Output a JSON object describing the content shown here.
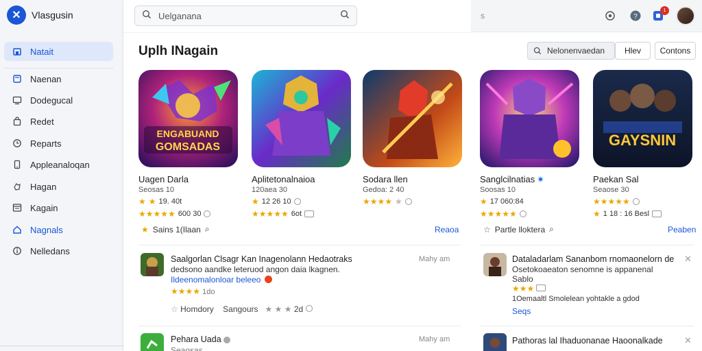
{
  "brand": {
    "name": "Vlasgusin",
    "color": "#1a56d6"
  },
  "sidebar": {
    "items": [
      {
        "label": "Natait",
        "icon": "home-icon",
        "active": true
      },
      {
        "label": "Naenan",
        "icon": "document-icon"
      },
      {
        "label": "Dodegucal",
        "icon": "monitor-icon"
      },
      {
        "label": "Redet",
        "icon": "bag-icon"
      },
      {
        "label": "Reparts",
        "icon": "clock-icon"
      },
      {
        "label": "Appleanaloqan",
        "icon": "phone-icon"
      },
      {
        "label": "Hagan",
        "icon": "hand-icon"
      },
      {
        "label": "Kagain",
        "icon": "window-icon"
      },
      {
        "label": "Nagnals",
        "icon": "house-icon",
        "accent": true
      },
      {
        "label": "Nelledans",
        "icon": "info-icon"
      }
    ]
  },
  "search": {
    "value": "Uelganana"
  },
  "page": {
    "title": "Uplh INagain"
  },
  "topbar": {
    "hint": "s",
    "badge": "1"
  },
  "filter": {
    "value": "Nelonenvaedan",
    "btn1": "Hlev",
    "btn2": "Contons"
  },
  "apps": [
    {
      "name": "Uagen Darla",
      "sub": "Seosas 10",
      "rating_line": "19. 40t",
      "meta_line": "600 30"
    },
    {
      "name": "Aplitetonalnaioa",
      "sub": "120aea 30",
      "rating_line": "12 26 10",
      "meta_line": "6ot"
    },
    {
      "name": "Sodara llen",
      "sub": "Gedoa: 2 40"
    },
    {
      "name": "Sanglcilnatias",
      "sub": "Soosas 10",
      "rating_line": "17 060:84",
      "verified": true
    },
    {
      "name": "Paekan Sal",
      "sub": "Seaose 30",
      "meta_line": "1 18 : 16 Besl"
    }
  ],
  "app_icon_texts": {
    "app1_l1": "ENGABUAND",
    "app1_l2": "GOMSADAS",
    "app5": "GAYSNIN"
  },
  "footers": {
    "left": "Sains 1(Ilaan",
    "left_link": "Reaoa",
    "right": "Partle lloktera",
    "right_link": "Peaben"
  },
  "list_left": [
    {
      "title": "Saalgorlan Clsagr Kan Inagenolann Hedaotraks",
      "line2": "dedsono aandke leteruod angon daia lkagnen.",
      "link": "Ildeenomalonloar beleeo",
      "rating": "1do",
      "tags": [
        "Homdory",
        "Sangours"
      ],
      "count": "2d",
      "side": "Mahy am"
    },
    {
      "title": "Pehara Uada",
      "line2": "Seaosas",
      "side": "Mahy am"
    }
  ],
  "list_right": [
    {
      "title": "Dataladarlam Sananbom rnomaonelorn de",
      "line2": "Osetokoaeaton senomne is appanenal",
      "line3": "Sablo",
      "meta": "1Oemaaltl Smolelean yohtakle a gdod",
      "link": "Seqs"
    },
    {
      "title": "Pathoras lal Ihaduonanae Haoonalkade"
    }
  ]
}
